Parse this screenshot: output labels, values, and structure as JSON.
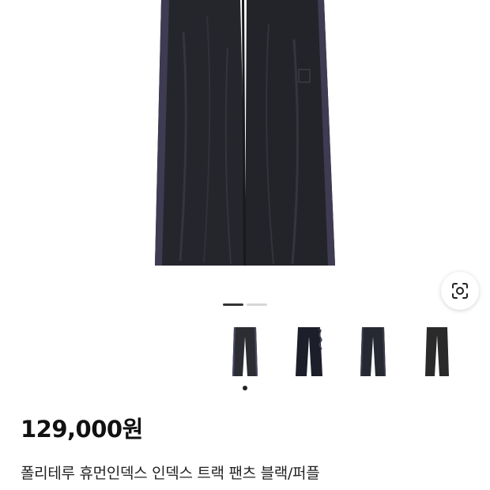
{
  "product": {
    "price": "129,000원",
    "title": "폴리테루 휴먼인덱스 인덱스 트랙 팬츠 블랙/퍼플"
  },
  "gallery": {
    "image_count": 2,
    "active_index": 0,
    "lens_icon": "visual-search-icon",
    "thumbnails": [
      {
        "color": "#2b2d33",
        "selected": true
      },
      {
        "color": "#1c1f2a",
        "selected": false
      },
      {
        "color": "#262832",
        "selected": false
      },
      {
        "color": "#2a2a2a",
        "selected": false
      }
    ]
  }
}
